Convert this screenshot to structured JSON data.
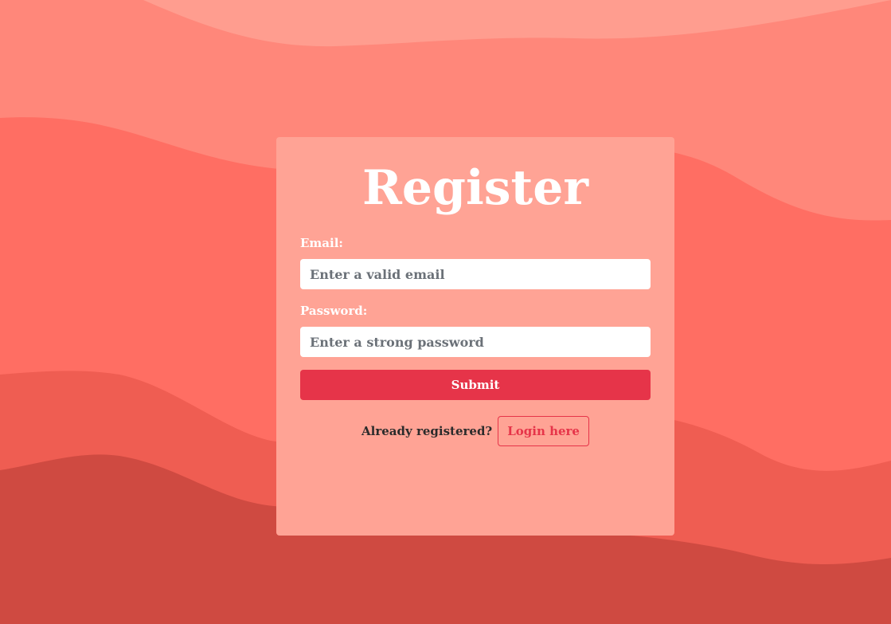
{
  "colors": {
    "wave_1": "#ff9d8f",
    "wave_2": "#ff877a",
    "wave_3": "#ff6e63",
    "wave_4": "#ef5d52",
    "wave_5": "#cf4a41",
    "card_bg": "#ffa395",
    "accent": "#e63449"
  },
  "form": {
    "title": "Register",
    "email_label": "Email:",
    "email_placeholder": "Enter a valid email",
    "email_value": "",
    "password_label": "Password:",
    "password_placeholder": "Enter a strong password",
    "password_value": "",
    "submit_label": "Submit"
  },
  "footer": {
    "prompt": "Already registered?",
    "login_label": "Login here"
  }
}
